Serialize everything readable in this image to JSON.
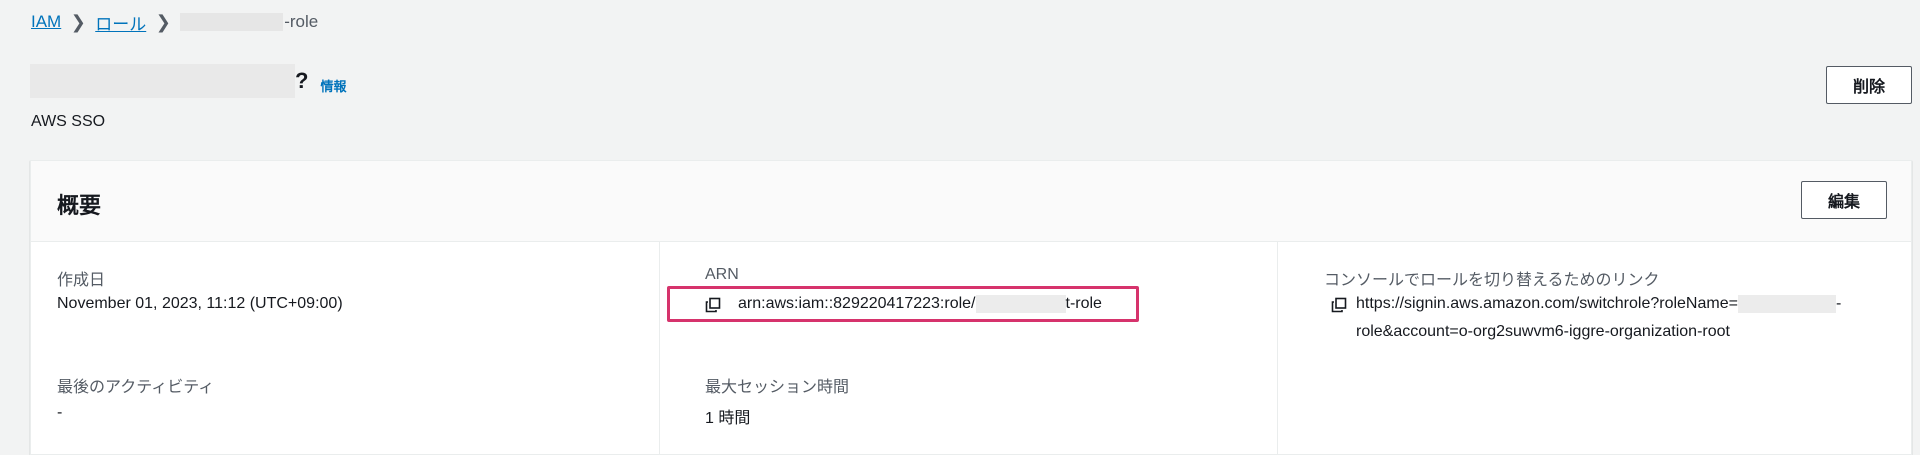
{
  "breadcrumb": {
    "items": [
      "IAM",
      "ロール"
    ],
    "current_suffix": "-role"
  },
  "header": {
    "title_tail": "?",
    "info_link": "情報",
    "subtitle": "AWS SSO",
    "delete_button": "削除"
  },
  "summary": {
    "title": "概要",
    "edit_button": "編集",
    "created": {
      "label": "作成日",
      "value": "November 01, 2023, 11:12 (UTC+09:00)"
    },
    "last_activity": {
      "label": "最後のアクティビティ",
      "value": "-"
    },
    "arn": {
      "label": "ARN",
      "prefix": "arn:aws:iam::829220417223:role/",
      "suffix": "t-role"
    },
    "max_session": {
      "label": "最大セッション時間",
      "value": "1 時間"
    },
    "switch_link": {
      "label": "コンソールでロールを切り替えるためのリンク",
      "line1_prefix": "https://signin.aws.amazon.com/switchrole?roleName=",
      "line1_suffix": "-",
      "line2": "role&account=o-org2suwvm6-iggre-organization-root"
    }
  },
  "colors": {
    "link": "#0073bb",
    "highlight": "#d6336c",
    "background": "#f2f3f3"
  },
  "icons": [
    "chevron-right-icon",
    "copy-icon"
  ]
}
